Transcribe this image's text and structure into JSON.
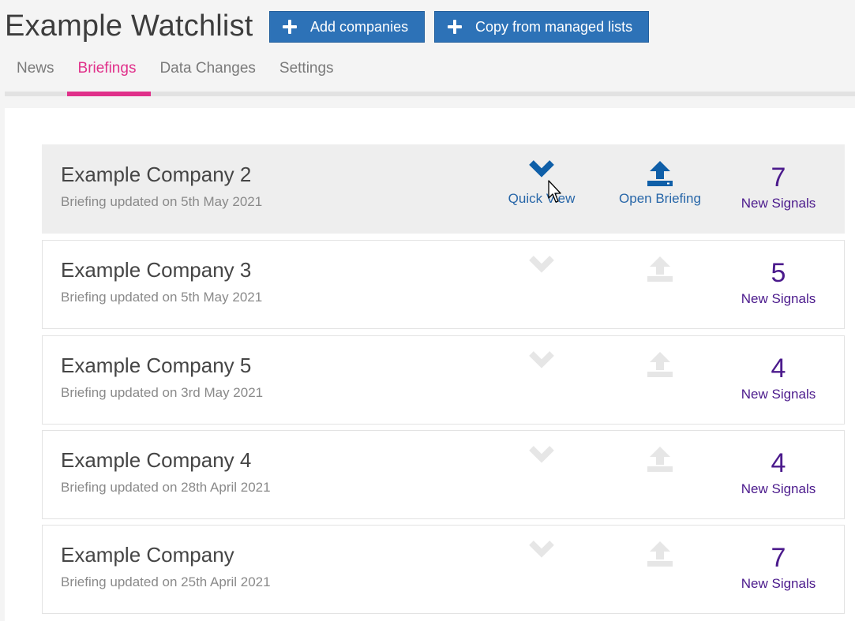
{
  "header": {
    "title": "Example Watchlist",
    "add_companies_label": "Add companies",
    "copy_lists_label": "Copy from managed lists"
  },
  "tabs": [
    {
      "label": "News",
      "active": false
    },
    {
      "label": "Briefings",
      "active": true
    },
    {
      "label": "Data Changes",
      "active": false
    },
    {
      "label": "Settings",
      "active": false
    }
  ],
  "colors": {
    "accent": "#e0308a",
    "button": "#2d72b7",
    "action_active": "#0f5fa8",
    "action_inactive": "#e6e6e6",
    "signals": "#4b1a8c"
  },
  "briefings": [
    {
      "company": "Example Company 2",
      "updated": "Briefing updated on 5th May 2021",
      "signals": "7",
      "signals_label": "New Signals",
      "quick_view_label": "Quick View",
      "open_briefing_label": "Open Briefing",
      "hovered": true
    },
    {
      "company": "Example Company 3",
      "updated": "Briefing updated on 5th May 2021",
      "signals": "5",
      "signals_label": "New Signals",
      "hovered": false
    },
    {
      "company": "Example Company 5",
      "updated": "Briefing updated on 3rd May 2021",
      "signals": "4",
      "signals_label": "New Signals",
      "hovered": false
    },
    {
      "company": "Example Company 4",
      "updated": "Briefing updated on 28th April 2021",
      "signals": "4",
      "signals_label": "New Signals",
      "hovered": false
    },
    {
      "company": "Example Company",
      "updated": "Briefing updated on 25th April 2021",
      "signals": "7",
      "signals_label": "New Signals",
      "hovered": false
    }
  ],
  "icons": {
    "add": "plus-icon",
    "quick_view": "chevron-down-icon",
    "open_briefing": "upload-icon",
    "cursor": "mouse-pointer-icon"
  }
}
